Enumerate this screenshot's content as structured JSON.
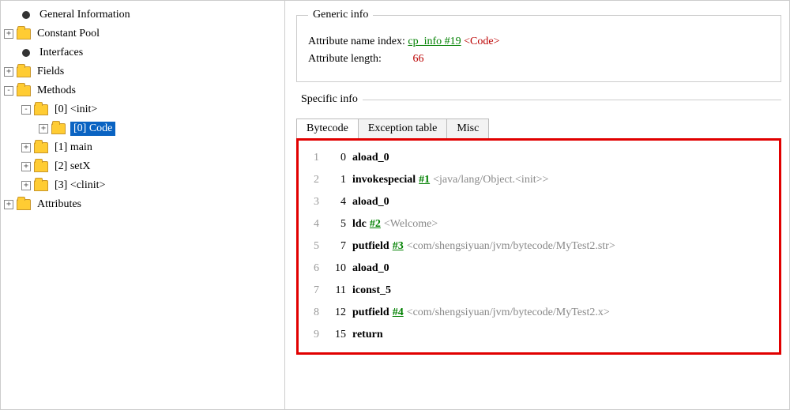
{
  "tree": {
    "general_info": "General Information",
    "constant_pool": "Constant Pool",
    "interfaces": "Interfaces",
    "fields": "Fields",
    "methods": "Methods",
    "method_0": "[0] <init>",
    "method_0_code": "[0] Code",
    "method_1": "[1] main",
    "method_2": "[2] setX",
    "method_3": "[3] <clinit>",
    "attributes": "Attributes"
  },
  "generic_info": {
    "legend": "Generic info",
    "attr_name_label": "Attribute name index:",
    "attr_name_link": "cp_info #19",
    "attr_name_tag": "<Code>",
    "attr_len_label": "Attribute length:",
    "attr_len_value": "66"
  },
  "specific_info": {
    "legend": "Specific info",
    "tabs": {
      "bytecode": "Bytecode",
      "exception": "Exception table",
      "misc": "Misc"
    },
    "bytecode": [
      {
        "n": "1",
        "off": "0",
        "op": "aload_0",
        "ref": "",
        "comment": ""
      },
      {
        "n": "2",
        "off": "1",
        "op": "invokespecial",
        "ref": "#1",
        "comment": "<java/lang/Object.<init>>"
      },
      {
        "n": "3",
        "off": "4",
        "op": "aload_0",
        "ref": "",
        "comment": ""
      },
      {
        "n": "4",
        "off": "5",
        "op": "ldc",
        "ref": "#2",
        "comment": "<Welcome>"
      },
      {
        "n": "5",
        "off": "7",
        "op": "putfield",
        "ref": "#3",
        "comment": "<com/shengsiyuan/jvm/bytecode/MyTest2.str>"
      },
      {
        "n": "6",
        "off": "10",
        "op": "aload_0",
        "ref": "",
        "comment": ""
      },
      {
        "n": "7",
        "off": "11",
        "op": "iconst_5",
        "ref": "",
        "comment": ""
      },
      {
        "n": "8",
        "off": "12",
        "op": "putfield",
        "ref": "#4",
        "comment": "<com/shengsiyuan/jvm/bytecode/MyTest2.x>"
      },
      {
        "n": "9",
        "off": "15",
        "op": "return",
        "ref": "",
        "comment": ""
      }
    ]
  }
}
